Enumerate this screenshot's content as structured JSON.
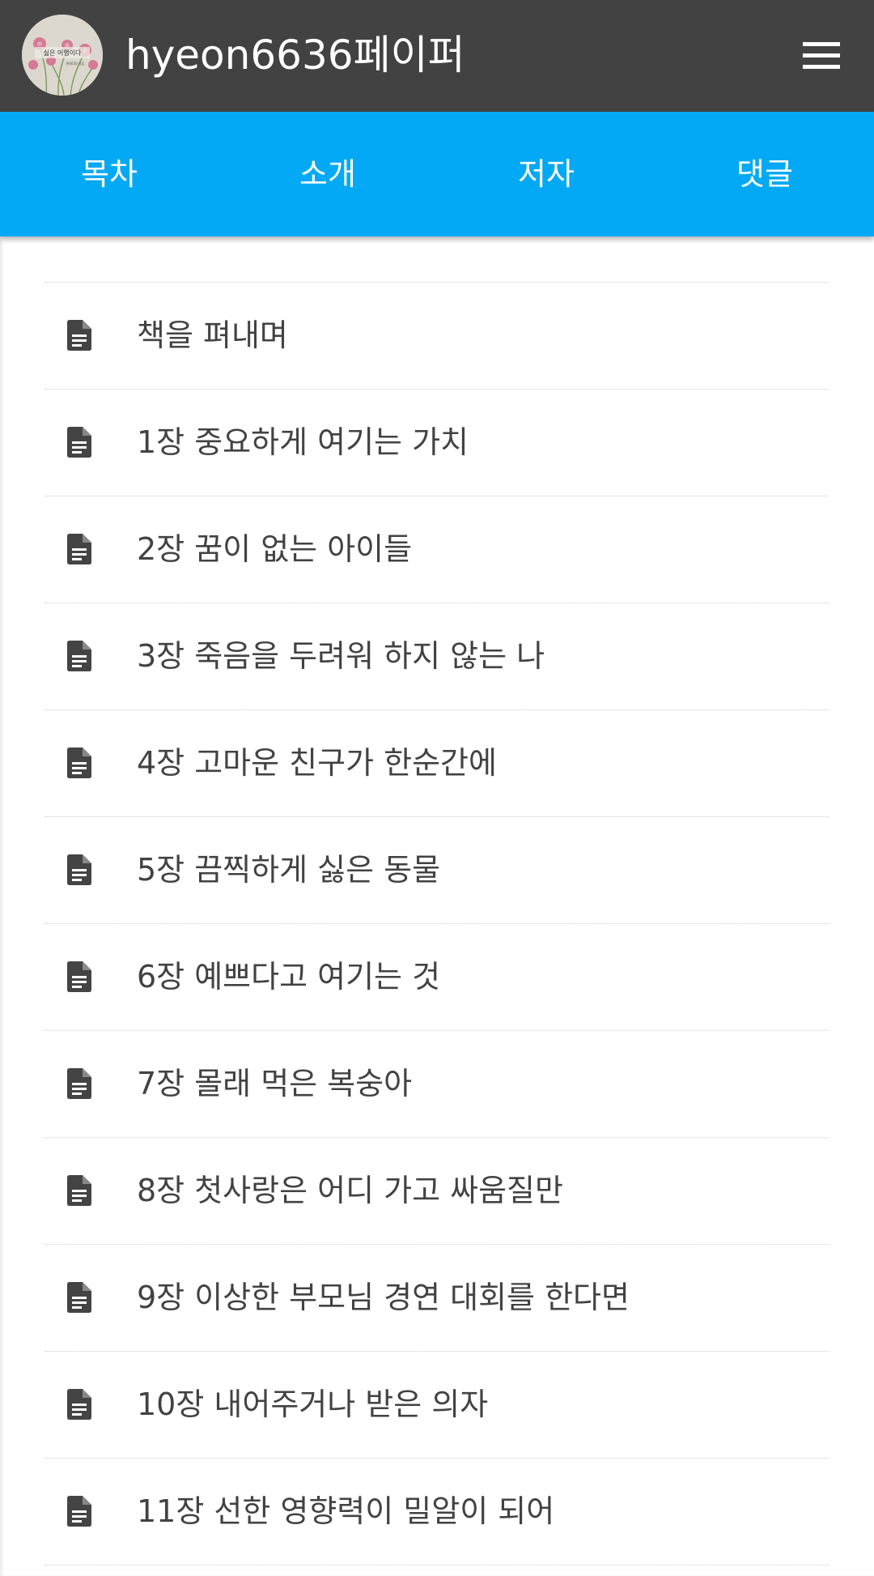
{
  "header": {
    "title": "hyeon6636페이퍼",
    "avatar": {
      "icon": "book-cover-avatar",
      "cover_title": "싫은 어행이다",
      "cover_subtitle": "현6636 지음"
    },
    "menu_icon": "hamburger-menu-icon"
  },
  "tabs": [
    {
      "label": "목차"
    },
    {
      "label": "소개"
    },
    {
      "label": "저자"
    },
    {
      "label": "댓글"
    }
  ],
  "toc": {
    "item_icon": "document-icon",
    "items": [
      {
        "label": "책을 펴내며"
      },
      {
        "label": "1장 중요하게 여기는 가치"
      },
      {
        "label": "2장 꿈이 없는 아이들"
      },
      {
        "label": "3장 죽음을 두려워 하지 않는 나"
      },
      {
        "label": "4장 고마운 친구가 한순간에"
      },
      {
        "label": "5장 끔찍하게 싫은 동물"
      },
      {
        "label": "6장 예쁘다고 여기는 것"
      },
      {
        "label": "7장 몰래 먹은 복숭아"
      },
      {
        "label": "8장 첫사랑은 어디 가고 싸움질만"
      },
      {
        "label": "9장 이상한 부모님 경연 대회를 한다면"
      },
      {
        "label": "10장 내어주거나 받은 의자"
      },
      {
        "label": "11장 선한 영향력이 밀알이 되어"
      }
    ]
  },
  "colors": {
    "app_bar": "#424242",
    "tab_bar": "#03a9f4",
    "text_primary": "#424242",
    "divider": "#cfcfcf"
  }
}
